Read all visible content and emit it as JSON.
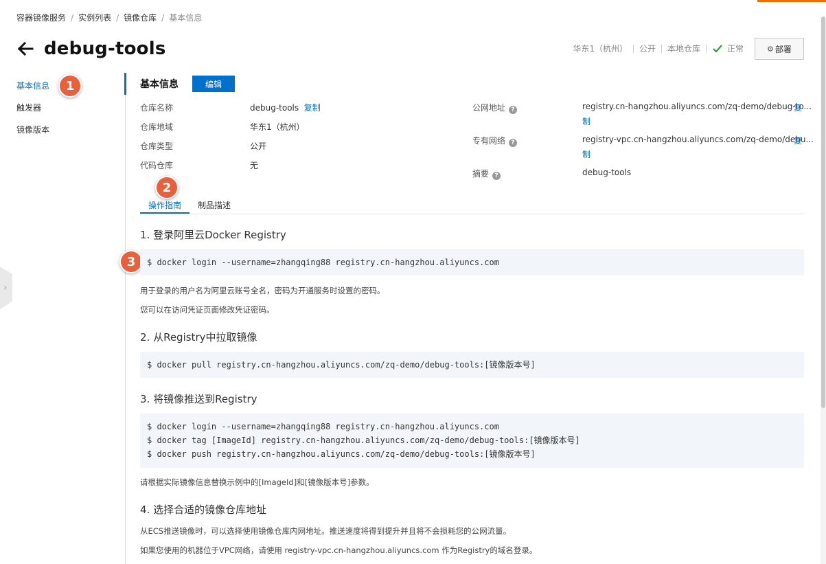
{
  "breadcrumb": [
    "容器镜像服务",
    "实例列表",
    "镜像仓库",
    "基本信息"
  ],
  "breadcrumb_sep": "/",
  "title": "debug-tools",
  "status": {
    "region": "华东1（杭州）",
    "visibility": "公开",
    "type": "本地仓库",
    "state": "正常"
  },
  "deploy_label": "部署",
  "sidenav": [
    "基本信息",
    "触发器",
    "镜像版本"
  ],
  "badges": [
    "1",
    "2",
    "3"
  ],
  "section": {
    "title": "基本信息",
    "edit_label": "编辑"
  },
  "info_left": [
    {
      "label": "仓库名称",
      "value": "debug-tools",
      "copy": "复制"
    },
    {
      "label": "仓库地域",
      "value": "华东1（杭州）"
    },
    {
      "label": "仓库类型",
      "value": "公开"
    },
    {
      "label": "代码仓库",
      "value": "无"
    }
  ],
  "info_right": [
    {
      "label": "公网地址",
      "value": "registry.cn-hangzhou.aliyuncs.com/zq-demo/debug-to...",
      "copy_1": "复",
      "copy_2": "制"
    },
    {
      "label": "专有网络",
      "value": "registry-vpc.cn-hangzhou.aliyuncs.com/zq-demo/debu...",
      "copy_1": "复",
      "copy_2": "制"
    },
    {
      "label": "摘要",
      "value": "debug-tools"
    }
  ],
  "tabs": [
    "操作指南",
    "制品描述"
  ],
  "steps": [
    {
      "title": "1. 登录阿里云Docker Registry",
      "code": [
        "$ docker login --username=zhangqing88 registry.cn-hangzhou.aliyuncs.com"
      ],
      "notes": [
        "用于登录的用户名为阿里云账号全名，密码为开通服务时设置的密码。",
        "您可以在访问凭证页面修改凭证密码。"
      ]
    },
    {
      "title": "2. 从Registry中拉取镜像",
      "code": [
        "$ docker pull registry.cn-hangzhou.aliyuncs.com/zq-demo/debug-tools:[镜像版本号]"
      ],
      "notes": []
    },
    {
      "title": "3. 将镜像推送到Registry",
      "code": [
        "$ docker login --username=zhangqing88 registry.cn-hangzhou.aliyuncs.com",
        "$ docker tag [ImageId] registry.cn-hangzhou.aliyuncs.com/zq-demo/debug-tools:[镜像版本号]",
        "$ docker push registry.cn-hangzhou.aliyuncs.com/zq-demo/debug-tools:[镜像版本号]"
      ],
      "notes": [
        "请根据实际镜像信息替换示例中的[ImageId]和[镜像版本号]参数。"
      ]
    },
    {
      "title": "4. 选择合适的镜像仓库地址",
      "code": [],
      "notes": [
        "从ECS推送镜像时，可以选择使用镜像仓库内网地址。推送速度将得到提升并且将不会损耗您的公网流量。",
        "如果您使用的机器位于VPC网络，请使用 registry-vpc.cn-hangzhou.aliyuncs.com 作为Registry的域名登录。"
      ]
    }
  ],
  "colors": {
    "accent": "#0070cc",
    "badge": "#e8603c",
    "success": "#2a9d3a"
  }
}
